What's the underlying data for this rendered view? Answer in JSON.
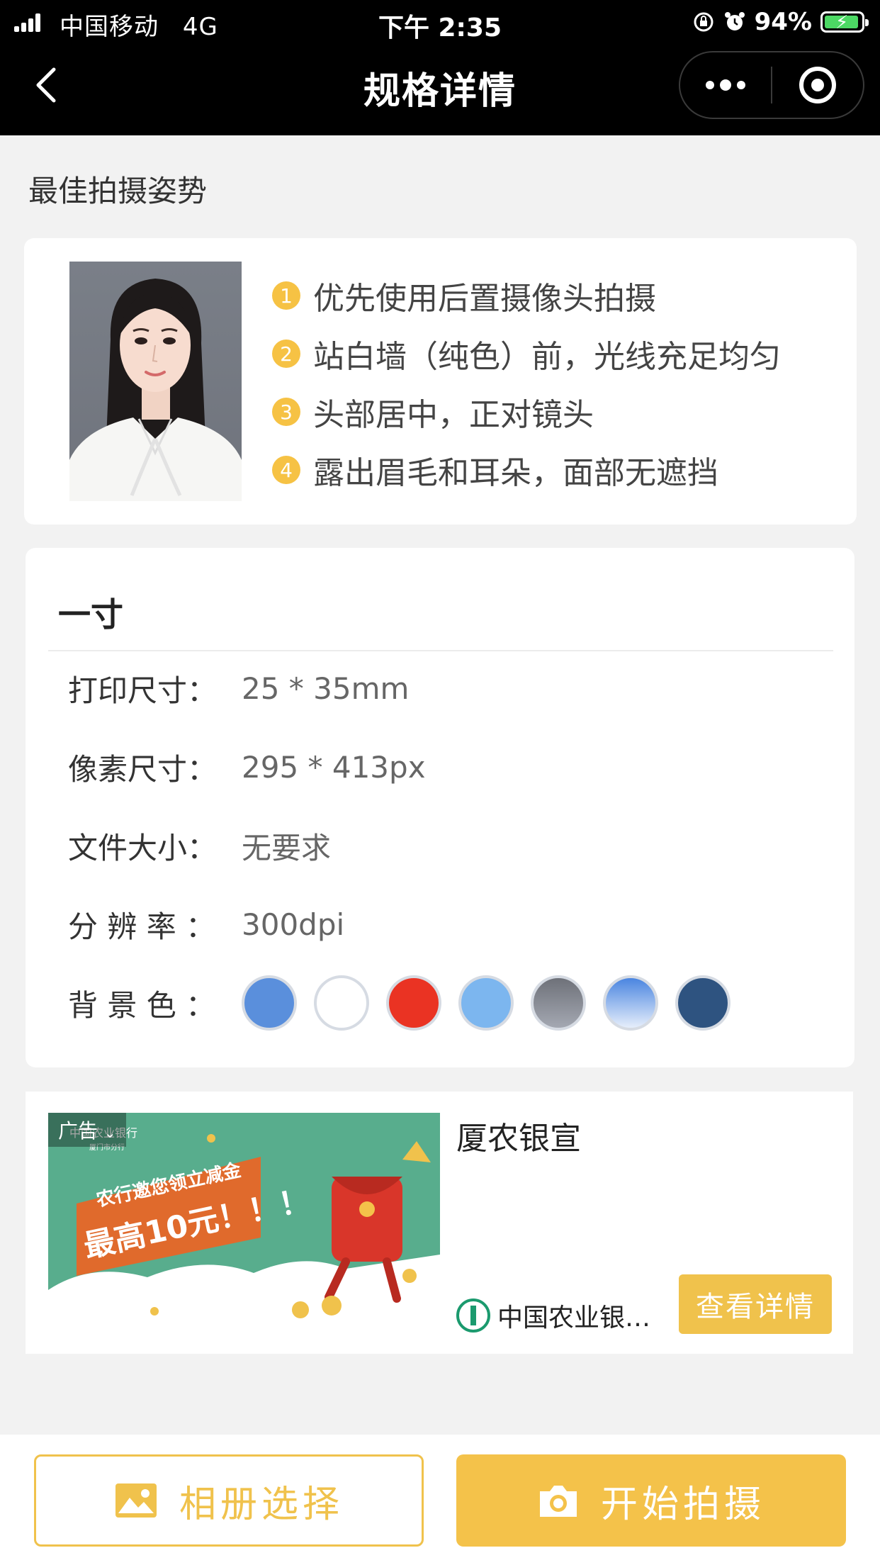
{
  "status_bar": {
    "carrier": "中国移动",
    "network": "4G",
    "time": "下午 2:35",
    "battery": "94%",
    "battery_level": 0.94
  },
  "nav": {
    "title": "规格详情",
    "back_icon": "chevron-left-icon",
    "more_icon": "more-dots-icon",
    "close_icon": "target-close-icon"
  },
  "pose": {
    "section_title": "最佳拍摄姿势",
    "tips": [
      {
        "num": "1",
        "text": "优先使用后置摄像头拍摄"
      },
      {
        "num": "2",
        "text": "站白墙（纯色）前，光线充足均匀"
      },
      {
        "num": "3",
        "text": "头部居中，正对镜头"
      },
      {
        "num": "4",
        "text": "露出眉毛和耳朵，面部无遮挡"
      }
    ]
  },
  "spec": {
    "title": "一寸",
    "rows": [
      {
        "label": "打印尺寸：",
        "value": "25 * 35mm"
      },
      {
        "label": "像素尺寸：",
        "value": "295 * 413px"
      },
      {
        "label": "文件大小：",
        "value": "无要求"
      },
      {
        "label": "分 辨 率 ：",
        "value": "300dpi"
      }
    ],
    "background_label": "背 景 色 ：",
    "background_colors": [
      "#5a8fdc",
      "#ffffff",
      "#ea3323",
      "#7cb6ef",
      "linear-gradient(180deg,#6e7179,#a4a8b2)",
      "linear-gradient(180deg,#4a85e0,#e6eefb)",
      "#2e5380"
    ]
  },
  "ad": {
    "tag": "广告",
    "tag_icon": "chevron-down-icon",
    "title": "厦农银宣",
    "brand": "中国农业银…",
    "button": "查看详情",
    "image_headline_1": "农行邀您领立减金",
    "image_headline_2": "最高10元！！！",
    "bank_logo_text": "中国农业银行",
    "branch_text": "厦门市分行"
  },
  "bottom": {
    "album_label": "相册选择",
    "album_icon": "image-icon",
    "shoot_label": "开始拍摄",
    "shoot_icon": "camera-icon"
  },
  "colors": {
    "accent": "#f4c24a",
    "nav_bg": "#000000",
    "page_bg": "#f2f2f2"
  }
}
